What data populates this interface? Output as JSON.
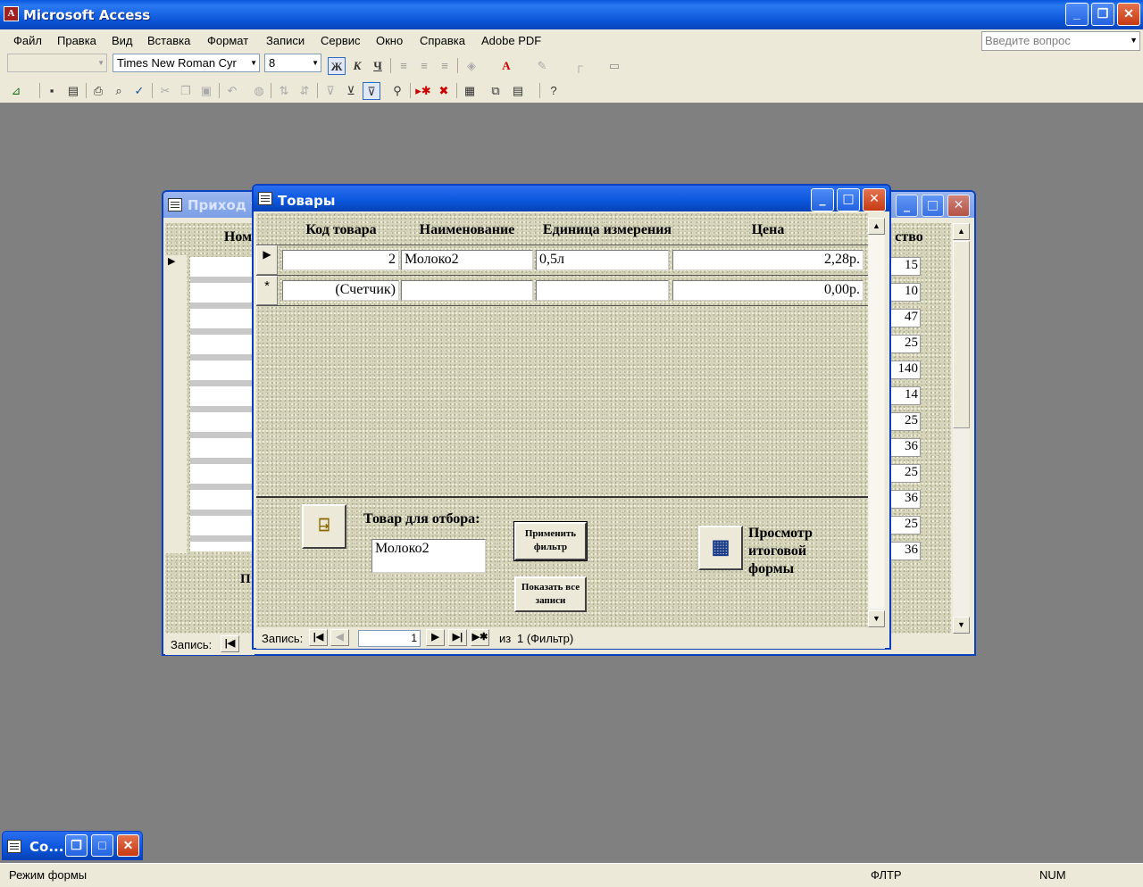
{
  "app": {
    "title": "Microsoft Access",
    "icon": "access-key-icon",
    "accent": "#0a58e0"
  },
  "menu": [
    "Файл",
    "Правка",
    "Вид",
    "Вставка",
    "Формат",
    "Записи",
    "Сервис",
    "Окно",
    "Справка",
    "Adobe PDF"
  ],
  "ask": {
    "placeholder": "Введите вопрос"
  },
  "format_toolbar": {
    "object_combo": "",
    "font": "Times New Roman Cyr",
    "size": "8",
    "bold": "Ж",
    "italic": "К",
    "underline": "Ч"
  },
  "back_window": {
    "title": "Приход т",
    "col_left": "Номе",
    "col_right": "ство",
    "values": [
      "15",
      "10",
      "47",
      "25",
      "140",
      "14",
      "25",
      "36",
      "25",
      "36",
      "25",
      "36"
    ],
    "nav_label": "Запись:",
    "footer_char": "П"
  },
  "front_window": {
    "title": "Товары",
    "headers": {
      "code": "Код товара",
      "name": "Наименование",
      "unit": "Единица измерения",
      "price": "Цена"
    },
    "rows": [
      {
        "code": "2",
        "name": "Молоко2",
        "unit": "0,5л",
        "price": "2,28р."
      }
    ],
    "new_row": {
      "code": "(Счетчик)",
      "name": "",
      "unit": "",
      "price": "0,00р."
    },
    "new_marker": "*",
    "filter_label": "Товар для отбора:",
    "filter_value": "Молоко2",
    "apply_button": "Применить фильтр",
    "show_all_button": "Показать все записи",
    "summary_label": "Просмотр итоговой формы",
    "nav": {
      "label": "Запись:",
      "current": "1",
      "of": "из",
      "total": "1 (Фильтр)"
    }
  },
  "minimized": {
    "title": "Со..."
  },
  "status": {
    "mode": "Режим формы",
    "filter": "ФЛТР",
    "num": "NUM"
  }
}
